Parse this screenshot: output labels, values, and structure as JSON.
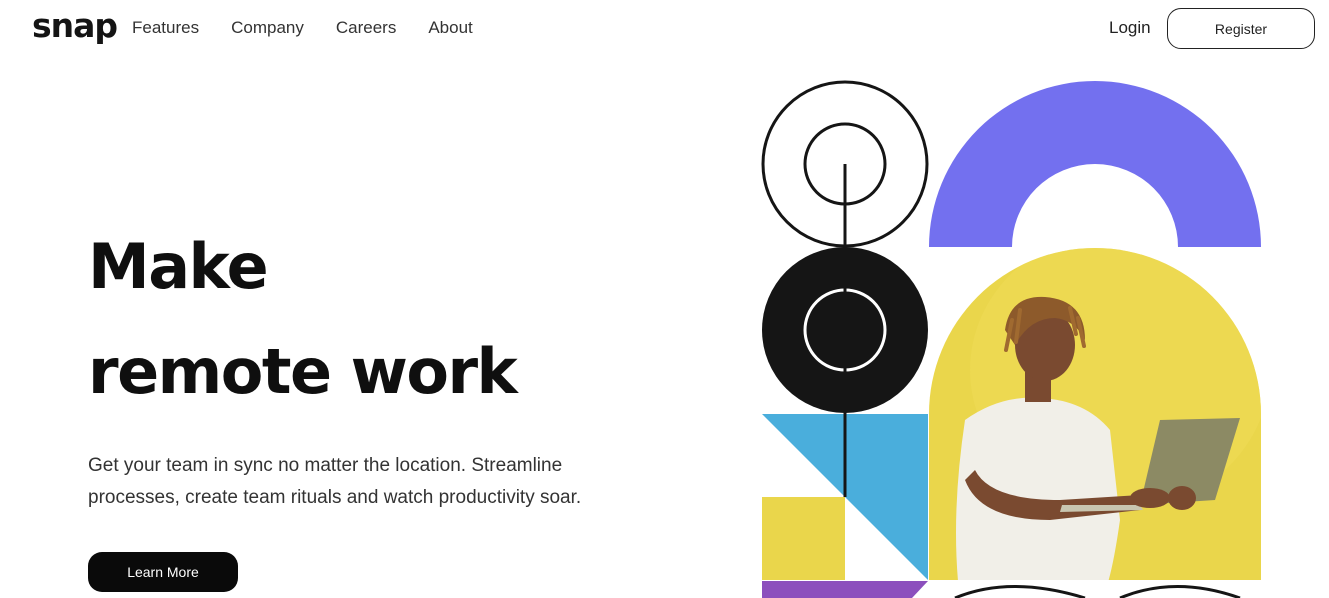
{
  "header": {
    "logo": "snap",
    "nav": [
      {
        "label": "Features"
      },
      {
        "label": "Company"
      },
      {
        "label": "Careers"
      },
      {
        "label": "About"
      }
    ],
    "login_label": "Login",
    "register_label": "Register"
  },
  "hero": {
    "title_line1": "Make",
    "title_line2": "remote work",
    "subtitle": "Get your team in sync no matter the location. Streamline processes, create team rituals and watch productivity soar.",
    "cta_label": "Learn More"
  },
  "illustration": {
    "colors": {
      "purple_arch": "#7370ef",
      "yellow": "#ead64b",
      "blue": "#4aaedc",
      "black": "#151515",
      "violet_bar": "#8c4fbd",
      "shirt": "#f1efe8",
      "skin": "#7a4a30",
      "laptop": "#8c8a64"
    }
  }
}
